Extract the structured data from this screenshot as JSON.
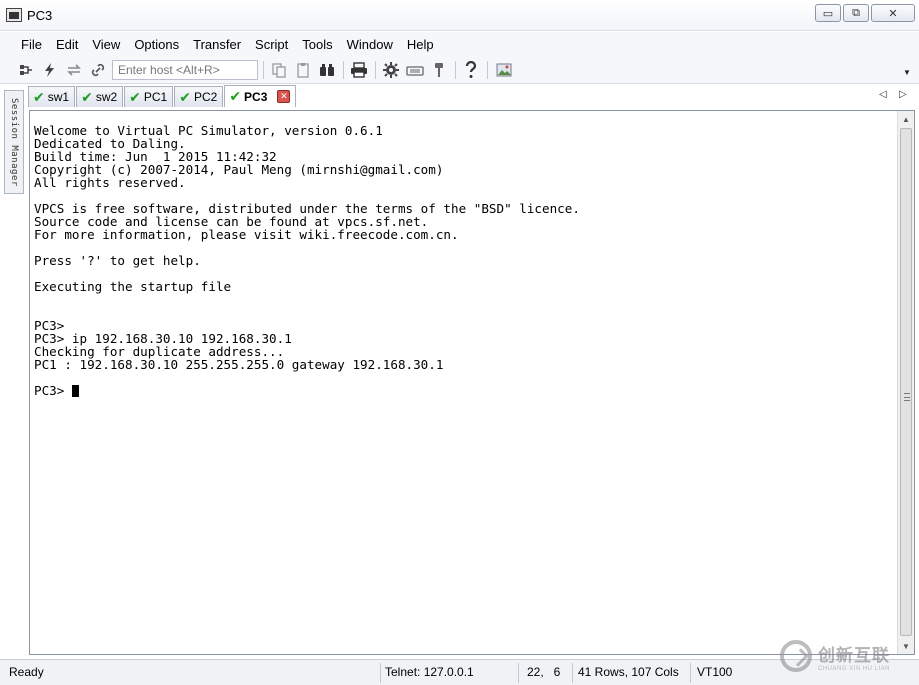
{
  "window": {
    "title": "PC3",
    "min_symbol": "▭",
    "max_symbol": "⧉",
    "close_symbol": "✕"
  },
  "menu": [
    "File",
    "Edit",
    "View",
    "Options",
    "Transfer",
    "Script",
    "Tools",
    "Window",
    "Help"
  ],
  "toolbar": {
    "host_placeholder": "Enter host <Alt+R>",
    "icons": [
      "connect-icon",
      "lightning-icon",
      "reconnect-icon",
      "link-icon",
      "copy-icon",
      "paste-icon",
      "find-icon",
      "print-icon",
      "gear-icon",
      "keymap-icon",
      "key-icon",
      "help-icon",
      "image-icon"
    ]
  },
  "side_panel": {
    "label": "Session Manager"
  },
  "tabs": [
    {
      "label": "sw1",
      "active": false
    },
    {
      "label": "sw2",
      "active": false
    },
    {
      "label": "PC1",
      "active": false
    },
    {
      "label": "PC2",
      "active": false
    },
    {
      "label": "PC3",
      "active": true
    }
  ],
  "terminal": {
    "lines": [
      "Welcome to Virtual PC Simulator, version 0.6.1",
      "Dedicated to Daling.",
      "Build time: Jun  1 2015 11:42:32",
      "Copyright (c) 2007-2014, Paul Meng (mirnshi@gmail.com)",
      "All rights reserved.",
      "",
      "VPCS is free software, distributed under the terms of the \"BSD\" licence.",
      "Source code and license can be found at vpcs.sf.net.",
      "For more information, please visit wiki.freecode.com.cn.",
      "",
      "Press '?' to get help.",
      "",
      "Executing the startup file",
      "",
      "",
      "PC3>",
      "PC3> ip 192.168.30.10 192.168.30.1",
      "Checking for duplicate address...",
      "PC1 : 192.168.30.10 255.255.255.0 gateway 192.168.30.1",
      ""
    ],
    "prompt": "PC3> "
  },
  "status": {
    "state": "Ready",
    "connection": "Telnet: 127.0.0.1",
    "cursor_pos": "22,   6",
    "dimensions": "41 Rows, 107 Cols",
    "emulation": "VT100"
  },
  "watermark": {
    "text": "创新互联",
    "sub": "CHUANG XIN HU LIAN"
  }
}
